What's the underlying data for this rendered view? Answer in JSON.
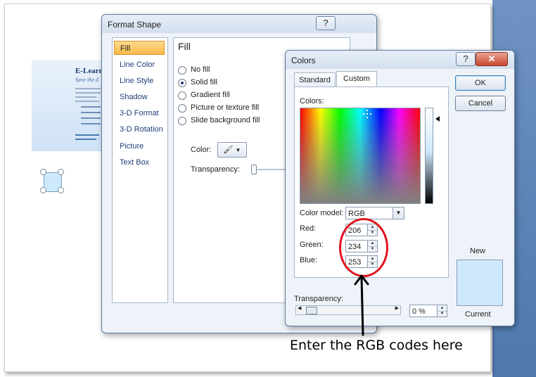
{
  "background_slide": {
    "thumbnail_title": "E-Learn",
    "thumbnail_tagline": "Save the d",
    "shape_fill_color": "#cee9fc"
  },
  "format_shape": {
    "title": "Format Shape",
    "help_label": "?",
    "nav_items": [
      "Fill",
      "Line Color",
      "Line Style",
      "Shadow",
      "3-D Format",
      "3-D Rotation",
      "Picture",
      "Text Box"
    ],
    "selected_nav": "Fill",
    "fill_heading": "Fill",
    "fill_options": [
      "No fill",
      "Solid fill",
      "Gradient fill",
      "Picture or texture fill",
      "Slide background fill"
    ],
    "selected_fill": "Solid fill",
    "color_label": "Color:",
    "transparency_label": "Transparency:",
    "transparency_value": 0
  },
  "colors_dialog": {
    "title": "Colors",
    "help_label": "?",
    "close_label": "✕",
    "tabs": [
      "Standard",
      "Custom"
    ],
    "active_tab": "Custom",
    "colors_label": "Colors:",
    "color_model_label": "Color model:",
    "color_model_value": "RGB",
    "red_label": "Red:",
    "red_value": "206",
    "green_label": "Green:",
    "green_value": "234",
    "blue_label": "Blue:",
    "blue_value": "253",
    "transparency_label": "Transparency:",
    "transparency_value": "0 %",
    "ok_label": "OK",
    "cancel_label": "Cancel",
    "new_label": "New",
    "current_label": "Current",
    "new_color": "#cee9fd"
  },
  "annotation": {
    "text": "Enter the RGB codes here",
    "color": "#e0141e"
  }
}
